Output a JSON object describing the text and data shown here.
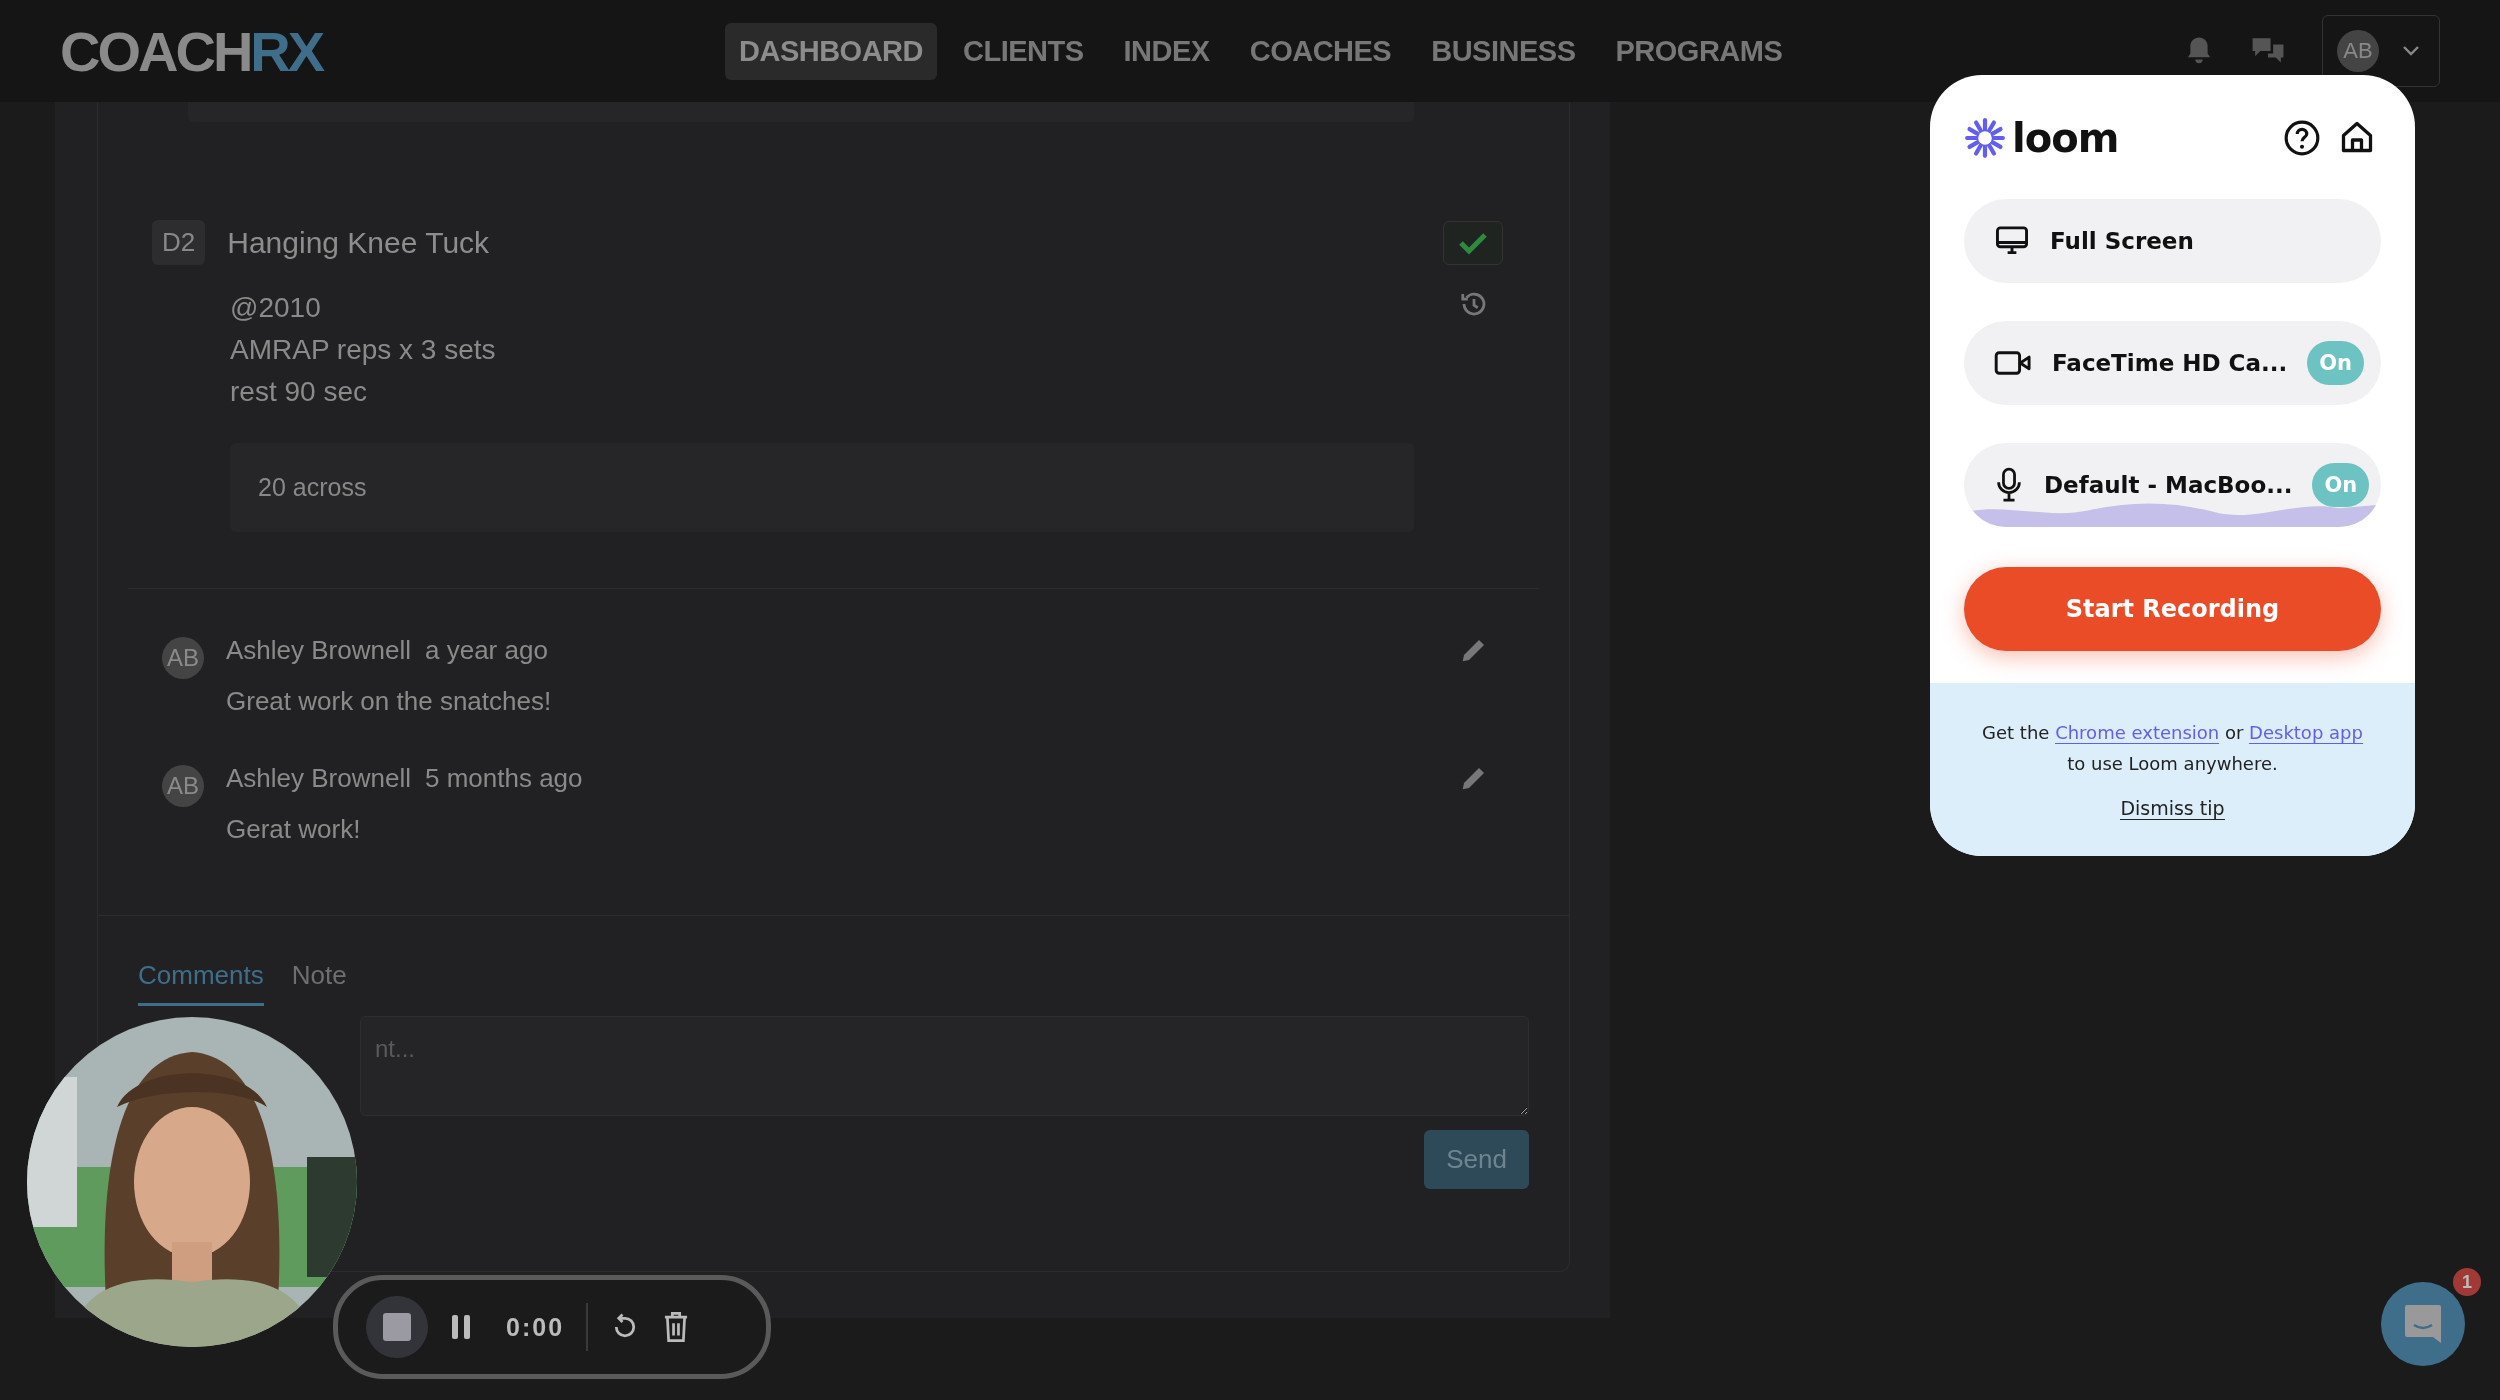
{
  "header": {
    "logo": {
      "part_1": "COACH",
      "part_2": "RX"
    },
    "nav": [
      {
        "label": "DASHBOARD",
        "selected": true
      },
      {
        "label": "CLIENTS",
        "selected": false
      },
      {
        "label": "INDEX",
        "selected": false
      },
      {
        "label": "COACHES",
        "selected": false
      },
      {
        "label": "BUSINESS",
        "selected": false
      },
      {
        "label": "PROGRAMS",
        "selected": false
      }
    ],
    "user_avatar": "AB"
  },
  "exercise": {
    "code": "D2",
    "name": "Hanging Knee Tuck",
    "completed": true,
    "details": [
      "@2010",
      "AMRAP reps x 3 sets",
      "rest 90 sec"
    ],
    "note": "20 across"
  },
  "comments": [
    {
      "avatar": "AB",
      "author": "Ashley Brownell",
      "time": "a year ago",
      "text": "Great work on the snatches!"
    },
    {
      "avatar": "AB",
      "author": "Ashley Brownell",
      "time": "5 months ago",
      "text": "Gerat work!"
    }
  ],
  "comment_tabs": [
    {
      "label": "Comments",
      "selected": true
    },
    {
      "label": "Note",
      "selected": false
    }
  ],
  "comment_field": {
    "placeholder": "nt..."
  },
  "send_button": "Send",
  "loom": {
    "logo": "loom",
    "sources": [
      {
        "kind": "screen",
        "label": "Full Screen"
      },
      {
        "kind": "camera",
        "label": "FaceTime HD Ca...",
        "on": true,
        "status": "On"
      },
      {
        "kind": "microphone",
        "label": "Default - MacBoo...",
        "on": true,
        "status": "On"
      }
    ],
    "start_button": "Start Recording",
    "tip": {
      "text_1": "Get the",
      "link_1": "Chrome extension",
      "text_2": "or",
      "link_2": "Desktop app",
      "text_3": "to use Loom anywhere."
    },
    "dismiss": "Dismiss tip"
  },
  "recorder": {
    "timer": "0:00"
  },
  "chat_widget": {
    "badge": "1"
  }
}
